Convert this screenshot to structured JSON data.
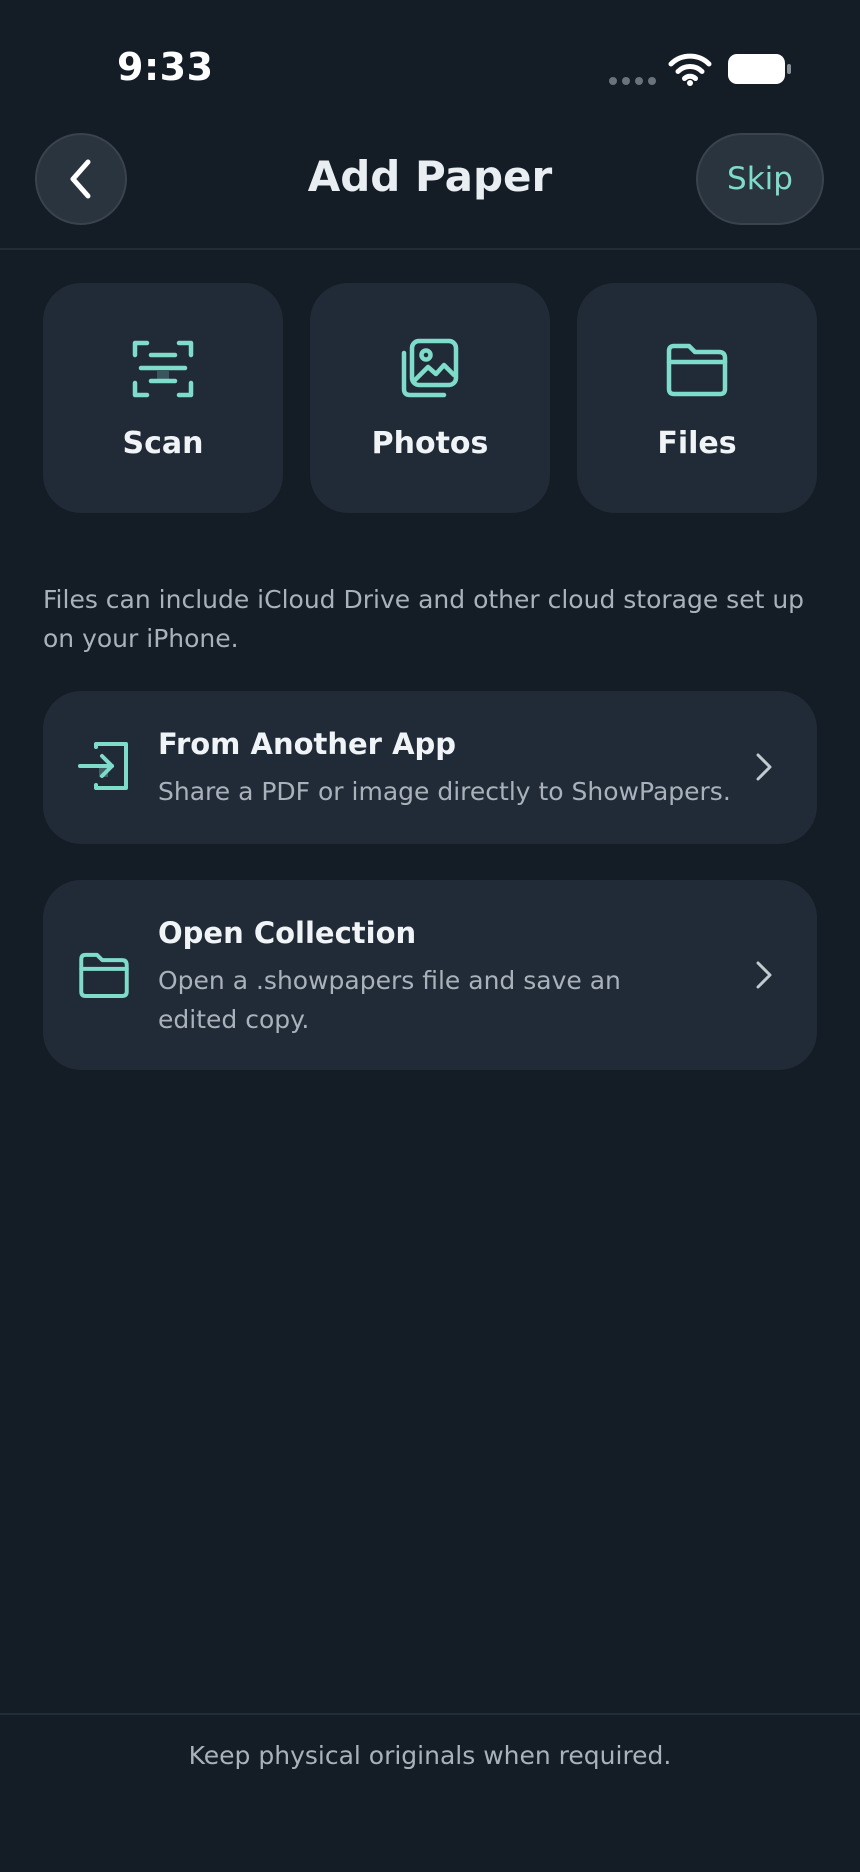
{
  "status_bar": {
    "time": "9:33",
    "icons": [
      "signal-dots-icon",
      "wifi-icon",
      "battery-icon"
    ]
  },
  "header": {
    "back_icon": "chevron-left-icon",
    "title": "Add Paper",
    "skip_label": "Skip"
  },
  "sources": [
    {
      "label": "Scan",
      "icon": "scan-document-icon"
    },
    {
      "label": "Photos",
      "icon": "photos-icon"
    },
    {
      "label": "Files",
      "icon": "folder-icon"
    }
  ],
  "files_note": "Files can include iCloud Drive and other cloud storage set up on your iPhone.",
  "options": [
    {
      "title": "From Another App",
      "subtitle": "Share a PDF or image directly to ShowPapers.",
      "icon": "import-arrow-icon"
    },
    {
      "title": "Open Collection",
      "subtitle": "Open a .showpapers file and save an edited copy.",
      "icon": "folder-icon"
    }
  ],
  "footer": {
    "note": "Keep physical originals when required."
  },
  "colors": {
    "background": "#141c25",
    "card": "#212b37",
    "accent": "#7fdccb",
    "text_primary": "#f1f4f6",
    "text_secondary": "#a9b2ba"
  }
}
